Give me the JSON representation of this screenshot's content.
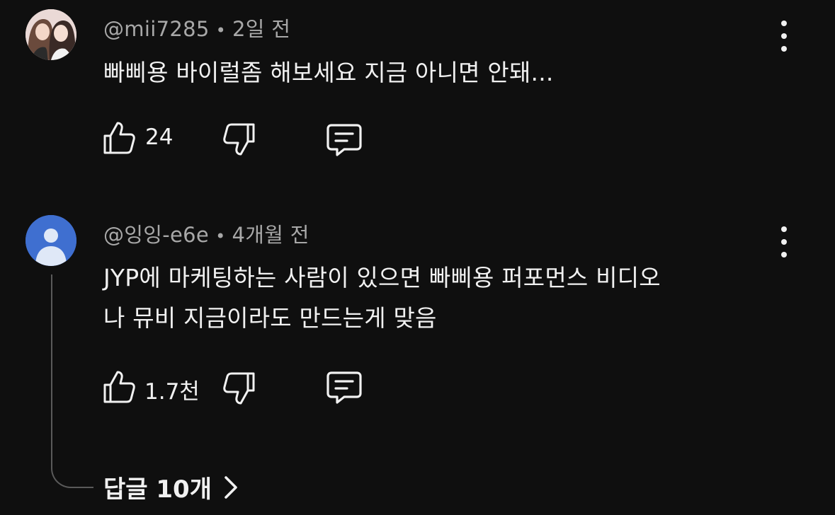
{
  "comments": [
    {
      "author": "@mii7285",
      "separator": "•",
      "time": "2일 전",
      "text_lines": [
        "빠삐용 바이럴좀 해보세요 지금 아니면 안돼..."
      ],
      "like_count": "24",
      "avatar_icon": "photo-avatar"
    },
    {
      "author": "@잉잉-e6e",
      "separator": "•",
      "time": "4개월 전",
      "text_lines": [
        "JYP에 마케팅하는 사람이 있으면 빠삐용 퍼포먼스 비디오",
        "나 뮤비 지금이라도 만드는게 맞음"
      ],
      "like_count": "1.7천",
      "avatar_icon": "default-user-avatar"
    }
  ],
  "replies_label": "답글 10개",
  "icons": {
    "like": "thumbs-up-icon",
    "dislike": "thumbs-down-icon",
    "reply": "comment-icon",
    "more": "more-vert-icon",
    "expand": "chevron-right-icon"
  },
  "colors": {
    "background": "#0f0f0f",
    "text": "#f1f1f1",
    "meta": "#a8a8a8",
    "default_avatar": "#3f6fd0"
  }
}
